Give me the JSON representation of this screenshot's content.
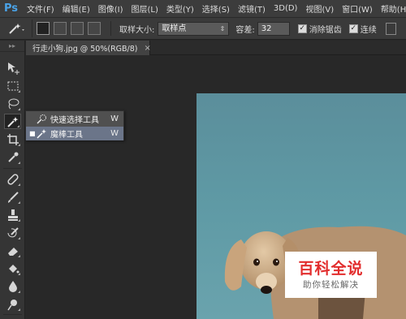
{
  "app": {
    "logo": "Ps",
    "brand_color": "#4aa3e8"
  },
  "menu": [
    {
      "label": "文件(F)"
    },
    {
      "label": "编辑(E)"
    },
    {
      "label": "图像(I)"
    },
    {
      "label": "图层(L)"
    },
    {
      "label": "类型(Y)"
    },
    {
      "label": "选择(S)"
    },
    {
      "label": "滤镜(T)"
    },
    {
      "label": "3D(D)"
    },
    {
      "label": "视图(V)"
    },
    {
      "label": "窗口(W)"
    },
    {
      "label": "帮助(H)"
    }
  ],
  "options": {
    "sample_size_label": "取样大小:",
    "sample_size_value": "取样点",
    "tolerance_label": "容差:",
    "tolerance_value": "32",
    "antialias_label": "消除锯齿",
    "antialias_checked": true,
    "contiguous_label": "连续",
    "contiguous_checked": true
  },
  "document": {
    "tab_title": "行走小狗.jpg @ 50%(RGB/8)",
    "close_glyph": "×"
  },
  "flyout": {
    "items": [
      {
        "label": "快速选择工具",
        "shortcut": "W",
        "icon": "quick-selection-icon",
        "selected": false
      },
      {
        "label": "魔棒工具",
        "shortcut": "W",
        "icon": "magic-wand-icon",
        "selected": true
      }
    ]
  },
  "watermark": {
    "title": "百科全说",
    "subtitle": "助你轻松解决",
    "title_color": "#e22d2d"
  }
}
